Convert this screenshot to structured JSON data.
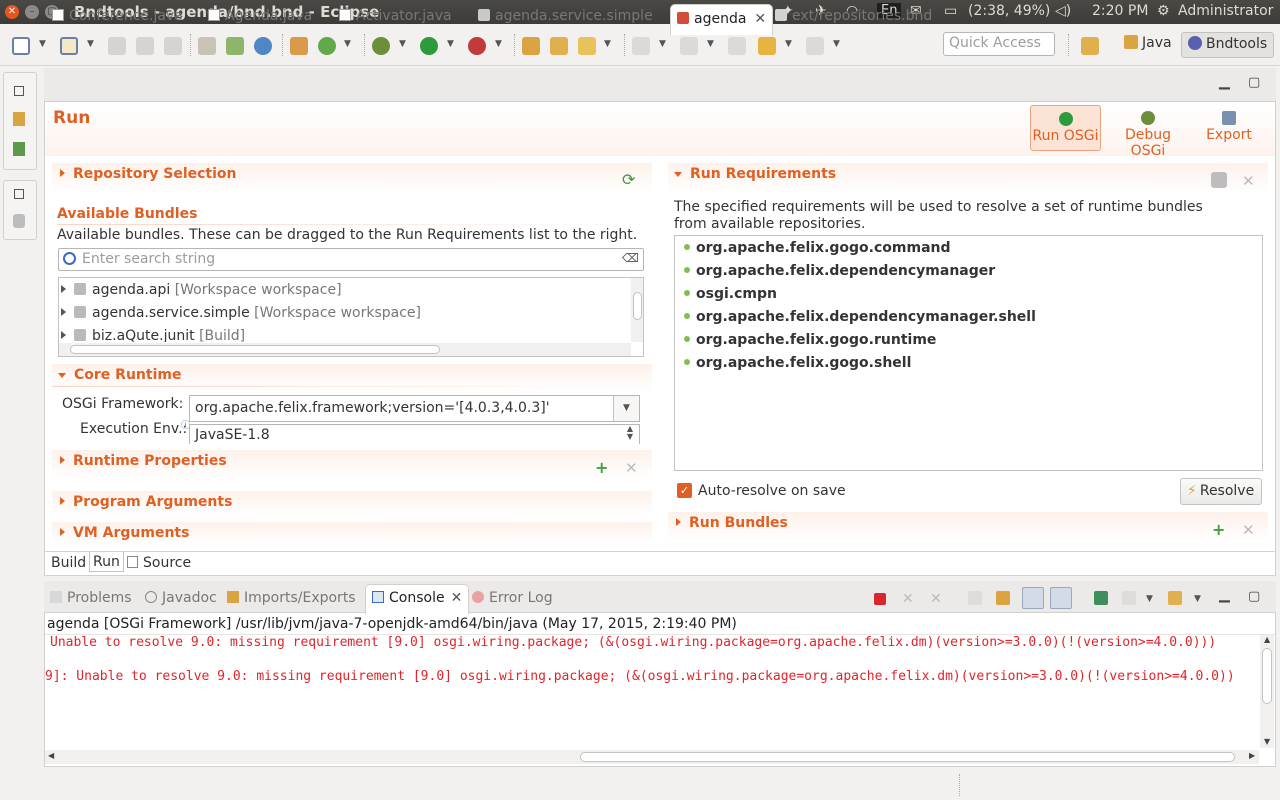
{
  "window": {
    "title": "Bndtools - agenda/bnd.bnd - Eclipse",
    "battery": "(2:38, 49%)",
    "clock": "2:20 PM",
    "user": "Administrator",
    "keyboard": "En"
  },
  "toolbar": {
    "quick_access_placeholder": "Quick Access",
    "perspectives": [
      "Java",
      "Bndtools"
    ]
  },
  "editor": {
    "tabs": [
      "Conference.java",
      "Agenda.java",
      "Activator.java",
      "agenda.service.simple",
      "agenda",
      "ext/repositories.bnd"
    ],
    "active_tab": "agenda",
    "form_title": "Run",
    "head_buttons": [
      "Run OSGi",
      "Debug OSGi",
      "Export"
    ],
    "repository_selection": {
      "title": "Repository Selection"
    },
    "available_bundles": {
      "title": "Available Bundles",
      "description": "Available bundles. These can be dragged to the Run Requirements list to the right.",
      "search_placeholder": "Enter search string",
      "items": [
        {
          "name": "agenda.api",
          "repo": "[Workspace workspace]"
        },
        {
          "name": "agenda.service.simple",
          "repo": "[Workspace workspace]"
        },
        {
          "name": "biz.aQute.junit",
          "repo": "[Build]"
        }
      ]
    },
    "core_runtime": {
      "title": "Core Runtime",
      "framework_label": "OSGi Framework:",
      "framework_value": "org.apache.felix.framework;version='[4.0.3,4.0.3]'",
      "exec_env_label": "Execution Env.:",
      "exec_env_value": "JavaSE-1.8"
    },
    "runtime_properties": {
      "title": "Runtime Properties"
    },
    "program_arguments": {
      "title": "Program Arguments"
    },
    "vm_arguments": {
      "title": "VM Arguments"
    },
    "run_requirements": {
      "title": "Run Requirements",
      "description": "The specified requirements will be used to resolve a set of runtime bundles from available repositories.",
      "items": [
        "org.apache.felix.gogo.command",
        "org.apache.felix.dependencymanager",
        "osgi.cmpn",
        "org.apache.felix.dependencymanager.shell",
        "org.apache.felix.gogo.runtime",
        "org.apache.felix.gogo.shell"
      ],
      "auto_resolve_label": "Auto-resolve on save",
      "auto_resolve_checked": true,
      "resolve_button": "Resolve"
    },
    "run_bundles": {
      "title": "Run Bundles"
    },
    "page_tabs": [
      "Build",
      "Run",
      "Source"
    ],
    "active_page_tab": "Run"
  },
  "console": {
    "tabs": [
      "Problems",
      "Javadoc",
      "Imports/Exports",
      "Console",
      "Error Log"
    ],
    "active_tab": "Console",
    "process": "agenda [OSGi Framework] /usr/lib/jvm/java-7-openjdk-amd64/bin/java (May 17, 2015, 2:19:40 PM)",
    "lines": [
      " Unable to resolve 9.0: missing requirement [9.0] osgi.wiring.package; (&(osgi.wiring.package=org.apache.felix.dm)(version>=3.0.0)(!(version>=4.0.0)))",
      "9]: Unable to resolve 9.0: missing requirement [9.0] osgi.wiring.package; (&(osgi.wiring.package=org.apache.felix.dm)(version>=3.0.0)(!(version>=4.0.0))"
    ]
  },
  "colors": {
    "accent": "#e06023",
    "error": "#e0242a",
    "titlebar": "#3c3b37"
  }
}
